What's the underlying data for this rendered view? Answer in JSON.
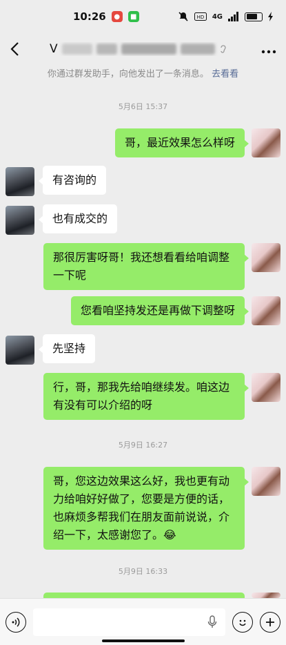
{
  "status": {
    "time": "10:26",
    "signal": "4G",
    "battery_level": 0.75
  },
  "header": {
    "title_visible": "V"
  },
  "system_notice": {
    "text": "你通过群发助手，向他发出了一条消息。",
    "link": "去看看"
  },
  "timestamps": [
    "5月6日 15:37",
    "5月9日 16:27",
    "5月9日 16:33"
  ],
  "messages": [
    {
      "side": "right",
      "text": "哥，最近效果怎么样呀"
    },
    {
      "side": "left",
      "text": "有咨询的"
    },
    {
      "side": "left",
      "text": "也有成交的"
    },
    {
      "side": "right",
      "text": "那很厉害呀哥！我还想看看给咱调整一下呢"
    },
    {
      "side": "right",
      "text": "您看咱坚持发还是再做下调整呀"
    },
    {
      "side": "left",
      "text": "先坚持"
    },
    {
      "side": "right",
      "text": "行，哥，那我先给咱继续发。咱这边有没有可以介绍的呀"
    },
    {
      "side": "right",
      "text": "哥，您这边效果这么好，我也更有动力给咱好好做了，您要是方便的话，也麻烦多帮我们在朋友面前说说，介绍一下，太感谢您了。😂"
    }
  ],
  "colors": {
    "sent_bubble": "#95ec69",
    "received_bubble": "#ffffff",
    "link": "#576b95",
    "background": "#ededed"
  },
  "icons": {
    "back": "chevron-left-icon",
    "more": "more-dots-icon",
    "voice": "voice-icon",
    "mic": "mic-icon",
    "emoji": "emoji-icon",
    "plus": "plus-icon"
  }
}
